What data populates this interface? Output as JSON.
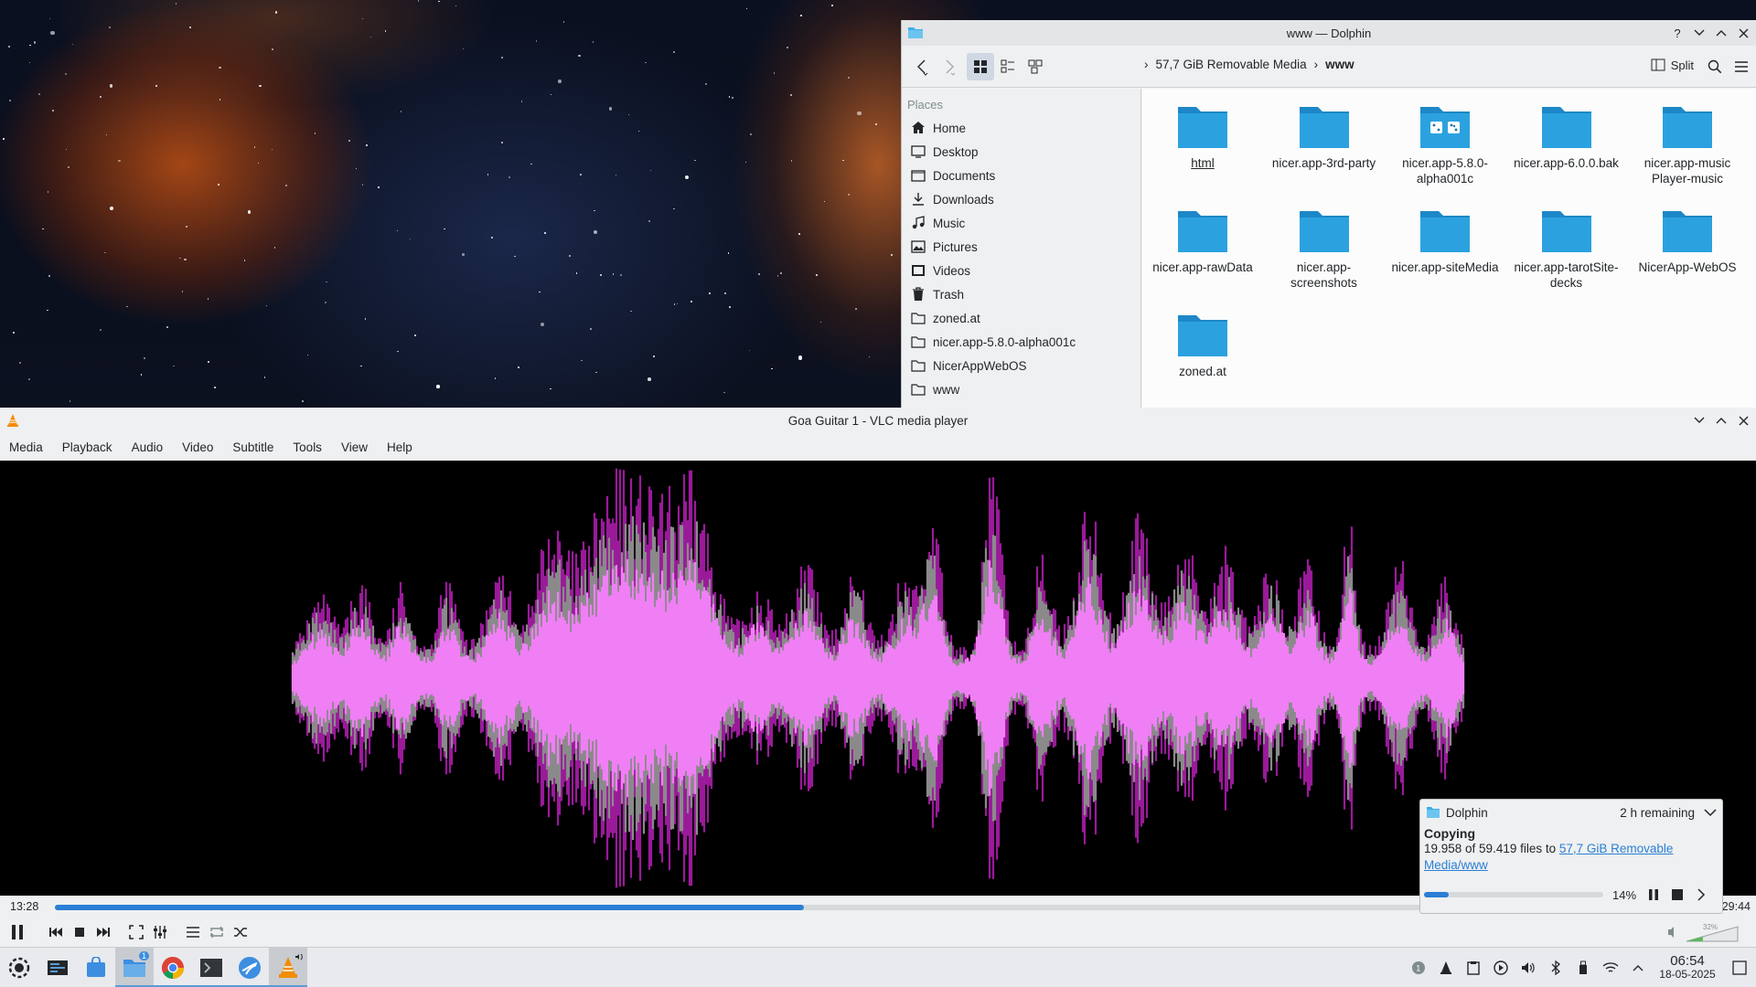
{
  "dolphin": {
    "title": "www — Dolphin",
    "breadcrumb": {
      "drive": "57,7 GiB Removable Media",
      "folder": "www"
    },
    "split_label": "Split",
    "places_title": "Places",
    "places": [
      {
        "label": "Home",
        "icon": "home-icon"
      },
      {
        "label": "Desktop",
        "icon": "desktop-icon"
      },
      {
        "label": "Documents",
        "icon": "documents-icon"
      },
      {
        "label": "Downloads",
        "icon": "downloads-icon"
      },
      {
        "label": "Music",
        "icon": "music-icon"
      },
      {
        "label": "Pictures",
        "icon": "pictures-icon"
      },
      {
        "label": "Videos",
        "icon": "videos-icon"
      },
      {
        "label": "Trash",
        "icon": "trash-icon"
      },
      {
        "label": "zoned.at",
        "icon": "folder-icon"
      },
      {
        "label": "nicer.app-5.8.0-alpha001c",
        "icon": "folder-icon"
      },
      {
        "label": "NicerAppWebOS",
        "icon": "folder-icon"
      },
      {
        "label": "www",
        "icon": "folder-icon"
      }
    ],
    "folders": [
      {
        "name_lines": [
          "html",
          ""
        ]
      },
      {
        "name_lines": [
          "nicer.app-3rd-party",
          ""
        ]
      },
      {
        "name_lines": [
          "nicer.app-5.8.0-",
          "alpha001c"
        ]
      },
      {
        "name_lines": [
          "nicer.app-6.0.0.bak",
          ""
        ]
      },
      {
        "name_lines": [
          "nicer.app-music",
          "Player-music"
        ]
      },
      {
        "name_lines": [
          "nicer.app-rawData",
          ""
        ]
      },
      {
        "name_lines": [
          "nicer.app-",
          "screenshots"
        ]
      },
      {
        "name_lines": [
          "nicer.app-siteMedia",
          ""
        ]
      },
      {
        "name_lines": [
          "nicer.app-tarotSite-",
          "decks"
        ]
      },
      {
        "name_lines": [
          "NicerApp-WebOS",
          ""
        ]
      },
      {
        "name_lines": [
          "zoned.at",
          ""
        ]
      }
    ]
  },
  "vlc": {
    "title": "Goa Guitar 1 - VLC media player",
    "menus": [
      "Media",
      "Playback",
      "Audio",
      "Video",
      "Subtitle",
      "Tools",
      "View",
      "Help"
    ],
    "time_elapsed": "13:28",
    "time_total": "29:44",
    "progress": 0.453,
    "volume_label": "32%",
    "volume_level": 0.32
  },
  "notification": {
    "app": "Dolphin",
    "remaining": "2 h remaining",
    "title": "Copying",
    "body_prefix": "19.958 of 59.419 files to ",
    "link": "57,7 GiB Removable Media/www",
    "percent_label": "14%",
    "progress": 0.14
  },
  "taskbar": {
    "tasks": [
      "application-launcher-icon",
      "pager-icon",
      "store-icon",
      "dolphin-icon",
      "chrome-icon",
      "konsole-icon",
      "system-settings-icon",
      "vlc-icon"
    ],
    "dolphin_badge": "1",
    "tray_badge": "1",
    "time": "06:54",
    "date": "18-05-2025"
  },
  "colors": {
    "accent": "#2a7fd4",
    "folder": "#2ba2df",
    "waveform_light": "#f07ff5",
    "waveform_dark": "#9a1a9a",
    "waveform_grey": "#8a8a8a"
  }
}
